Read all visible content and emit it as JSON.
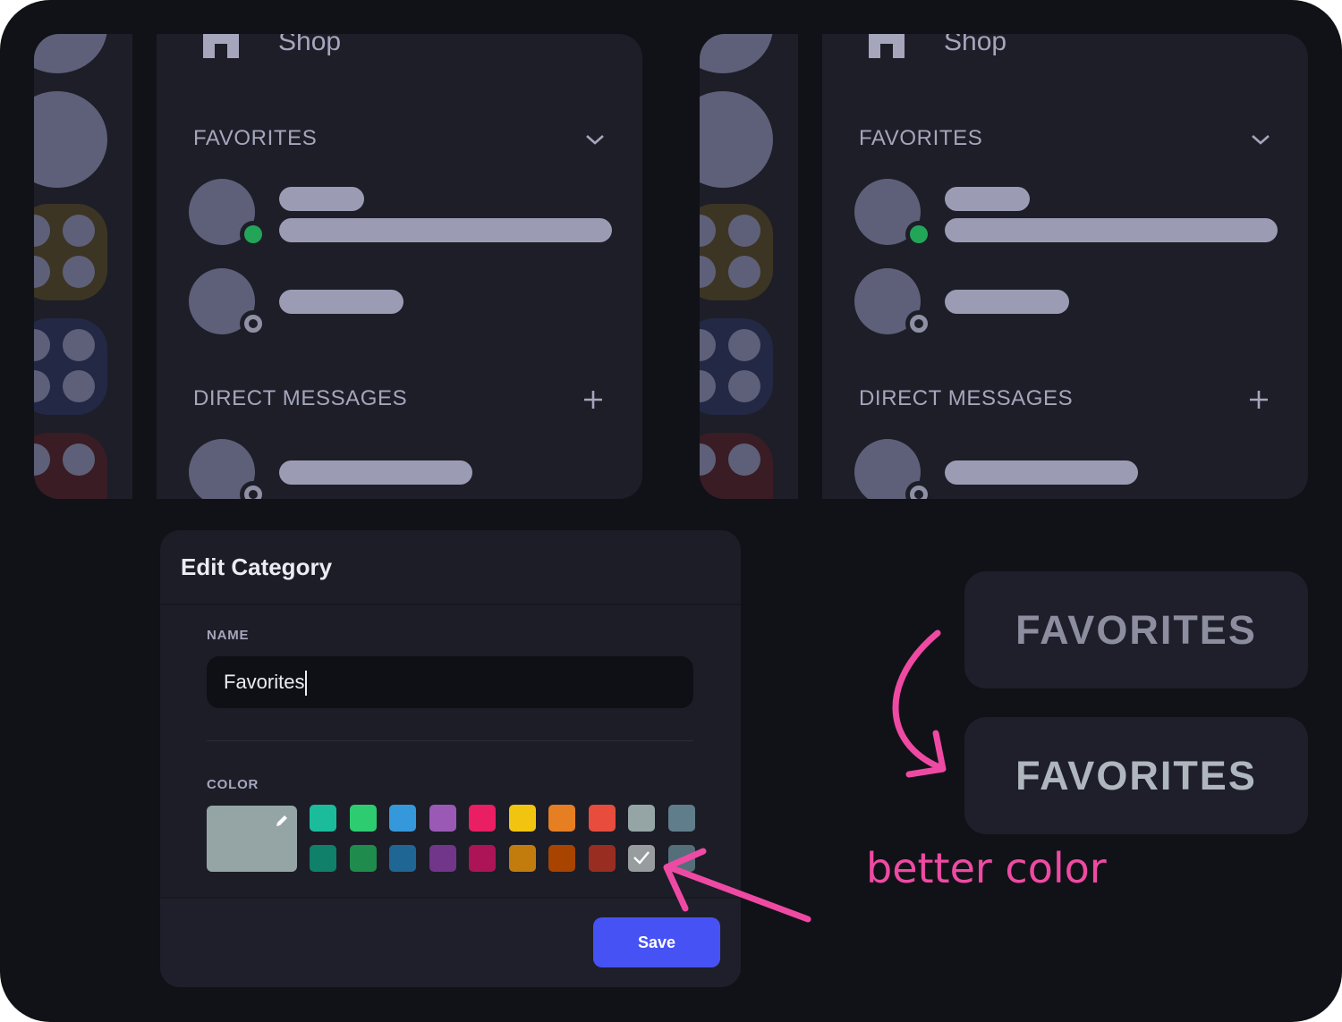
{
  "panels": [
    {
      "shop_label": "Shop",
      "favorites_header": "FAVORITES",
      "direct_messages_header": "DIRECT MESSAGES",
      "collapse_icon": "chevron-down-icon",
      "add_icon": "plus-icon"
    },
    {
      "shop_label": "Shop",
      "favorites_header": "FAVORITES",
      "direct_messages_header": "DIRECT MESSAGES",
      "collapse_icon": "chevron-down-icon",
      "add_icon": "plus-icon"
    }
  ],
  "dialog": {
    "title": "Edit Category",
    "name_label": "NAME",
    "name_value": "Favorites",
    "color_label": "COLOR",
    "custom_color": "#95a5a6",
    "swatches_row1": [
      "#1abc9c",
      "#2ecc71",
      "#3498db",
      "#9b59b6",
      "#e91e63",
      "#f1c40f",
      "#e67e22",
      "#e74c3c",
      "#95a5a6",
      "#607d8b"
    ],
    "swatches_row2": [
      "#11806a",
      "#1f8b4c",
      "#206694",
      "#71368a",
      "#ad1457",
      "#c27c0e",
      "#a84300",
      "#992d22",
      "#979c9f",
      "#546e7a"
    ],
    "selected_swatch": "#979c9f",
    "save_label": "Save"
  },
  "comparison": {
    "before_text": "FAVORITES",
    "after_text": "FAVORITES",
    "before_color": "#8c8d9f",
    "after_color": "#b0b6be"
  },
  "annotation": {
    "text": "better color",
    "color": "#ef4aa3"
  }
}
